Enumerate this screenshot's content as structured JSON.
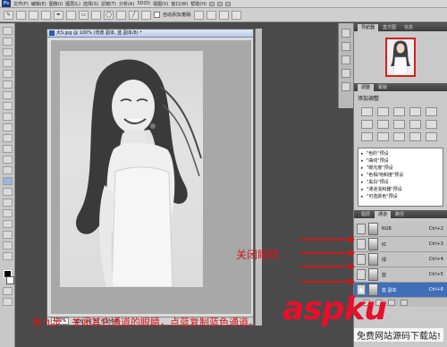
{
  "menubar": {
    "items": [
      "文件(F)",
      "编辑(E)",
      "图像(I)",
      "图层(L)",
      "选择(S)",
      "滤镜(T)",
      "分析(A)",
      "3D(D)",
      "视图(V)",
      "窗口(W)",
      "帮助(H)"
    ]
  },
  "options_bar": {
    "checkbox_label": "自动添加/删除"
  },
  "document": {
    "title": "大S.jpg @ 100% (背景 副本, 蓝 副本/8) *",
    "zoom": "100%",
    "status": "曝光只在 32 位起作用"
  },
  "panels": {
    "top_tabs": [
      "导航器",
      "直方图",
      "信息"
    ],
    "adjust_tabs": [
      "调整",
      "蒙版"
    ],
    "adjust_title": "添加调整",
    "presets": [
      "\"色阶\"预设",
      "\"曲线\"预设",
      "\"曝光度\"预设",
      "\"色相/饱和度\"预设",
      "\"黑白\"预设",
      "\"通道混和器\"预设",
      "\"可选颜色\"预设"
    ],
    "channel_tabs": [
      "图层",
      "通道",
      "路径"
    ],
    "channels": [
      {
        "name": "RGB",
        "shortcut": "Ctrl+2"
      },
      {
        "name": "红",
        "shortcut": "Ctrl+3"
      },
      {
        "name": "绿",
        "shortcut": "Ctrl+4"
      },
      {
        "name": "蓝",
        "shortcut": "Ctrl+5"
      },
      {
        "name": "蓝 副本",
        "shortcut": "Ctrl+6"
      }
    ]
  },
  "annotation": {
    "label": "关闭眼睛",
    "step": "第九步：关闭其它通道的眼睛，点蓝复制蓝色通道。"
  },
  "watermark": {
    "main": "aspku",
    "sub": "免费网站源码下载站!"
  },
  "colors": {
    "annotation_red": "#d01818",
    "selected_channel": "#3f6fb8",
    "watermark_red": "#e8102a"
  }
}
